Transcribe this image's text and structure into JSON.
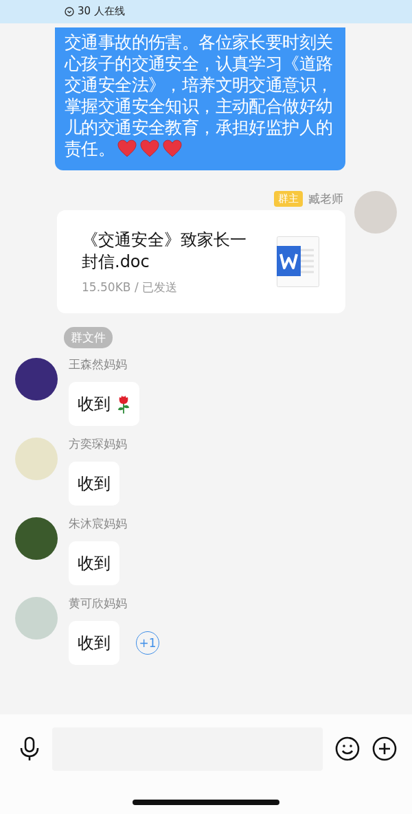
{
  "header": {
    "online": "30 人在线"
  },
  "announcement": {
    "text": "交通事故的伤害。各位家长要时刻关心孩子的交通安全，认真学习《道路交通安全法》，培养文明交通意识，掌握交通安全知识，主动配合做好幼儿的交通安全教育，承担好监护人的责任。",
    "emoji": [
      {
        "kind": "heart"
      },
      {
        "kind": "heart"
      },
      {
        "kind": "heart"
      }
    ]
  },
  "file_message": {
    "role_badge": "群主",
    "sender": "臧老师",
    "file_name": "《交通安全》致家长一封信.doc",
    "meta": "15.50KB / 已发送",
    "tag": "群文件"
  },
  "replies": [
    {
      "sender": "王森然妈妈",
      "text": "收到",
      "emoji": [
        {
          "kind": "rose"
        }
      ]
    },
    {
      "sender": "方奕琛妈妈",
      "text": "收到"
    },
    {
      "sender": "朱沐宸妈妈",
      "text": "收到"
    },
    {
      "sender": "黄可欣妈妈",
      "text": "收到",
      "plus_one": "+1"
    }
  ]
}
